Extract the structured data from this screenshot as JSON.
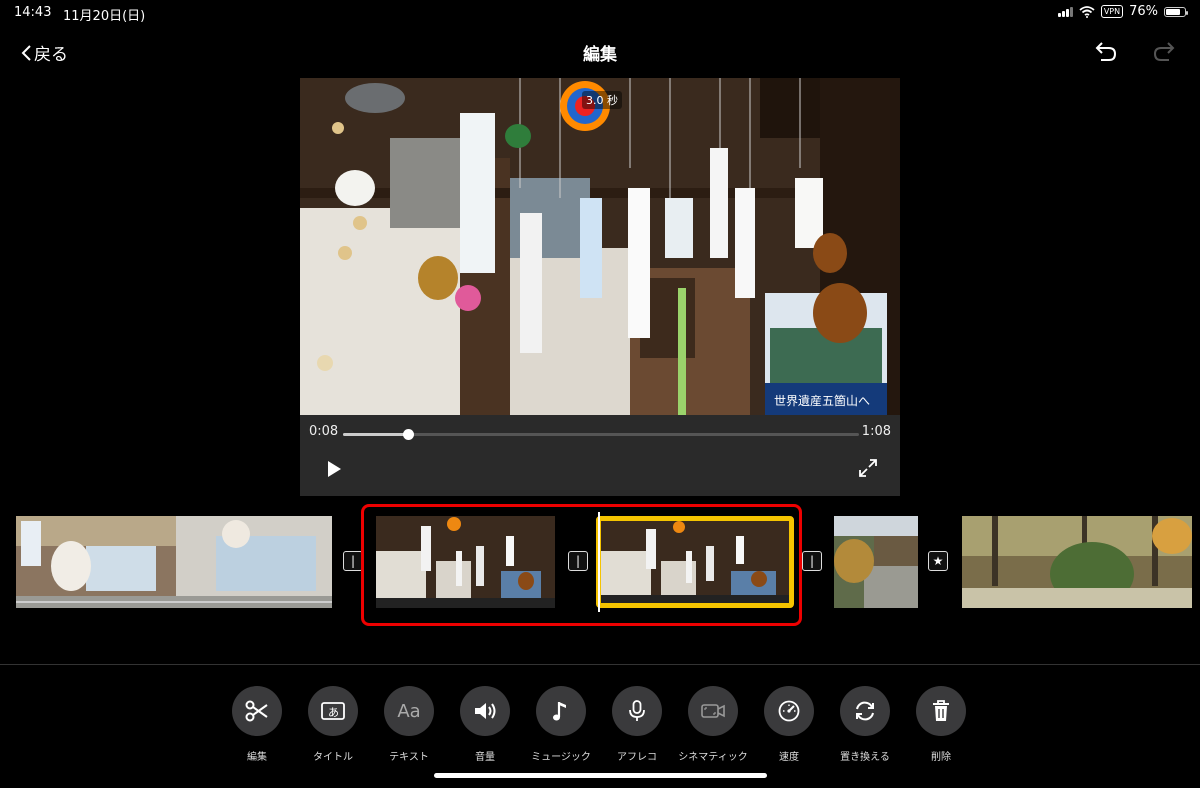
{
  "status_bar": {
    "time": "14:43",
    "date": "11月20日(日)",
    "vpn": "VPN",
    "battery": "76%",
    "battery_level": 0.76
  },
  "nav": {
    "back_label": "戻る",
    "title": "編集",
    "undo_icon": "undo-arrow-icon",
    "redo_icon": "redo-arrow-icon"
  },
  "viewer": {
    "duration_badge": "3.0 秒",
    "current_time": "0:08",
    "total_time": "1:08",
    "progress": 0.125,
    "sign_text": "世界遺産五箇山へ"
  },
  "toolbar": {
    "tools": [
      {
        "label": "編集",
        "icon": "scissors-icon"
      },
      {
        "label": "タイトル",
        "icon": "title-icon"
      },
      {
        "label": "テキスト",
        "icon": "text-icon",
        "glyph": "Aa"
      },
      {
        "label": "音量",
        "icon": "speaker-icon"
      },
      {
        "label": "ミュージック",
        "icon": "music-note-icon"
      },
      {
        "label": "アフレコ",
        "icon": "microphone-icon"
      },
      {
        "label": "シネマティック",
        "icon": "cinematic-camera-icon"
      },
      {
        "label": "速度",
        "icon": "speedometer-icon"
      },
      {
        "label": "置き換える",
        "icon": "replace-icon"
      },
      {
        "label": "削除",
        "icon": "trash-icon"
      }
    ]
  },
  "colors": {
    "selection_red": "#e00000",
    "clip_yellow": "#f5c400",
    "button_gray": "#3a3a3c"
  }
}
